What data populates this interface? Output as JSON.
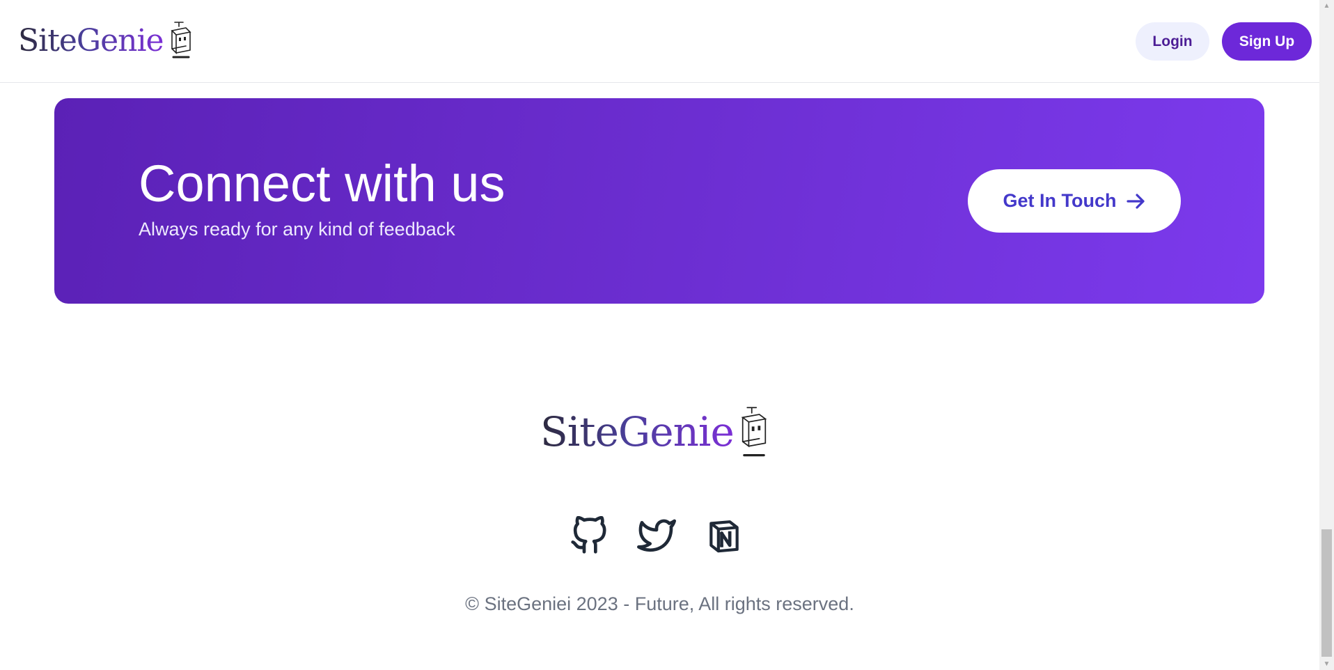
{
  "brand": {
    "name": "SiteGenie",
    "logo_icon": "robot-box-icon"
  },
  "header": {
    "login_label": "Login",
    "signup_label": "Sign Up"
  },
  "cta": {
    "title": "Connect with us",
    "subtitle": "Always ready for any kind of feedback",
    "button_label": "Get In Touch",
    "button_icon": "arrow-right-icon"
  },
  "footer": {
    "socials": [
      {
        "name": "GitHub",
        "icon": "github-icon"
      },
      {
        "name": "Twitter",
        "icon": "twitter-icon"
      },
      {
        "name": "Notion",
        "icon": "notion-icon"
      }
    ],
    "copyright": "© SiteGeniei 2023 - Future, All rights reserved."
  },
  "colors": {
    "accent": "#6d28d9",
    "cta_gradient_start": "#5b21b6",
    "cta_gradient_end": "#7c3aed",
    "login_bg": "#eef0fd",
    "button_text": "#4338ca"
  }
}
